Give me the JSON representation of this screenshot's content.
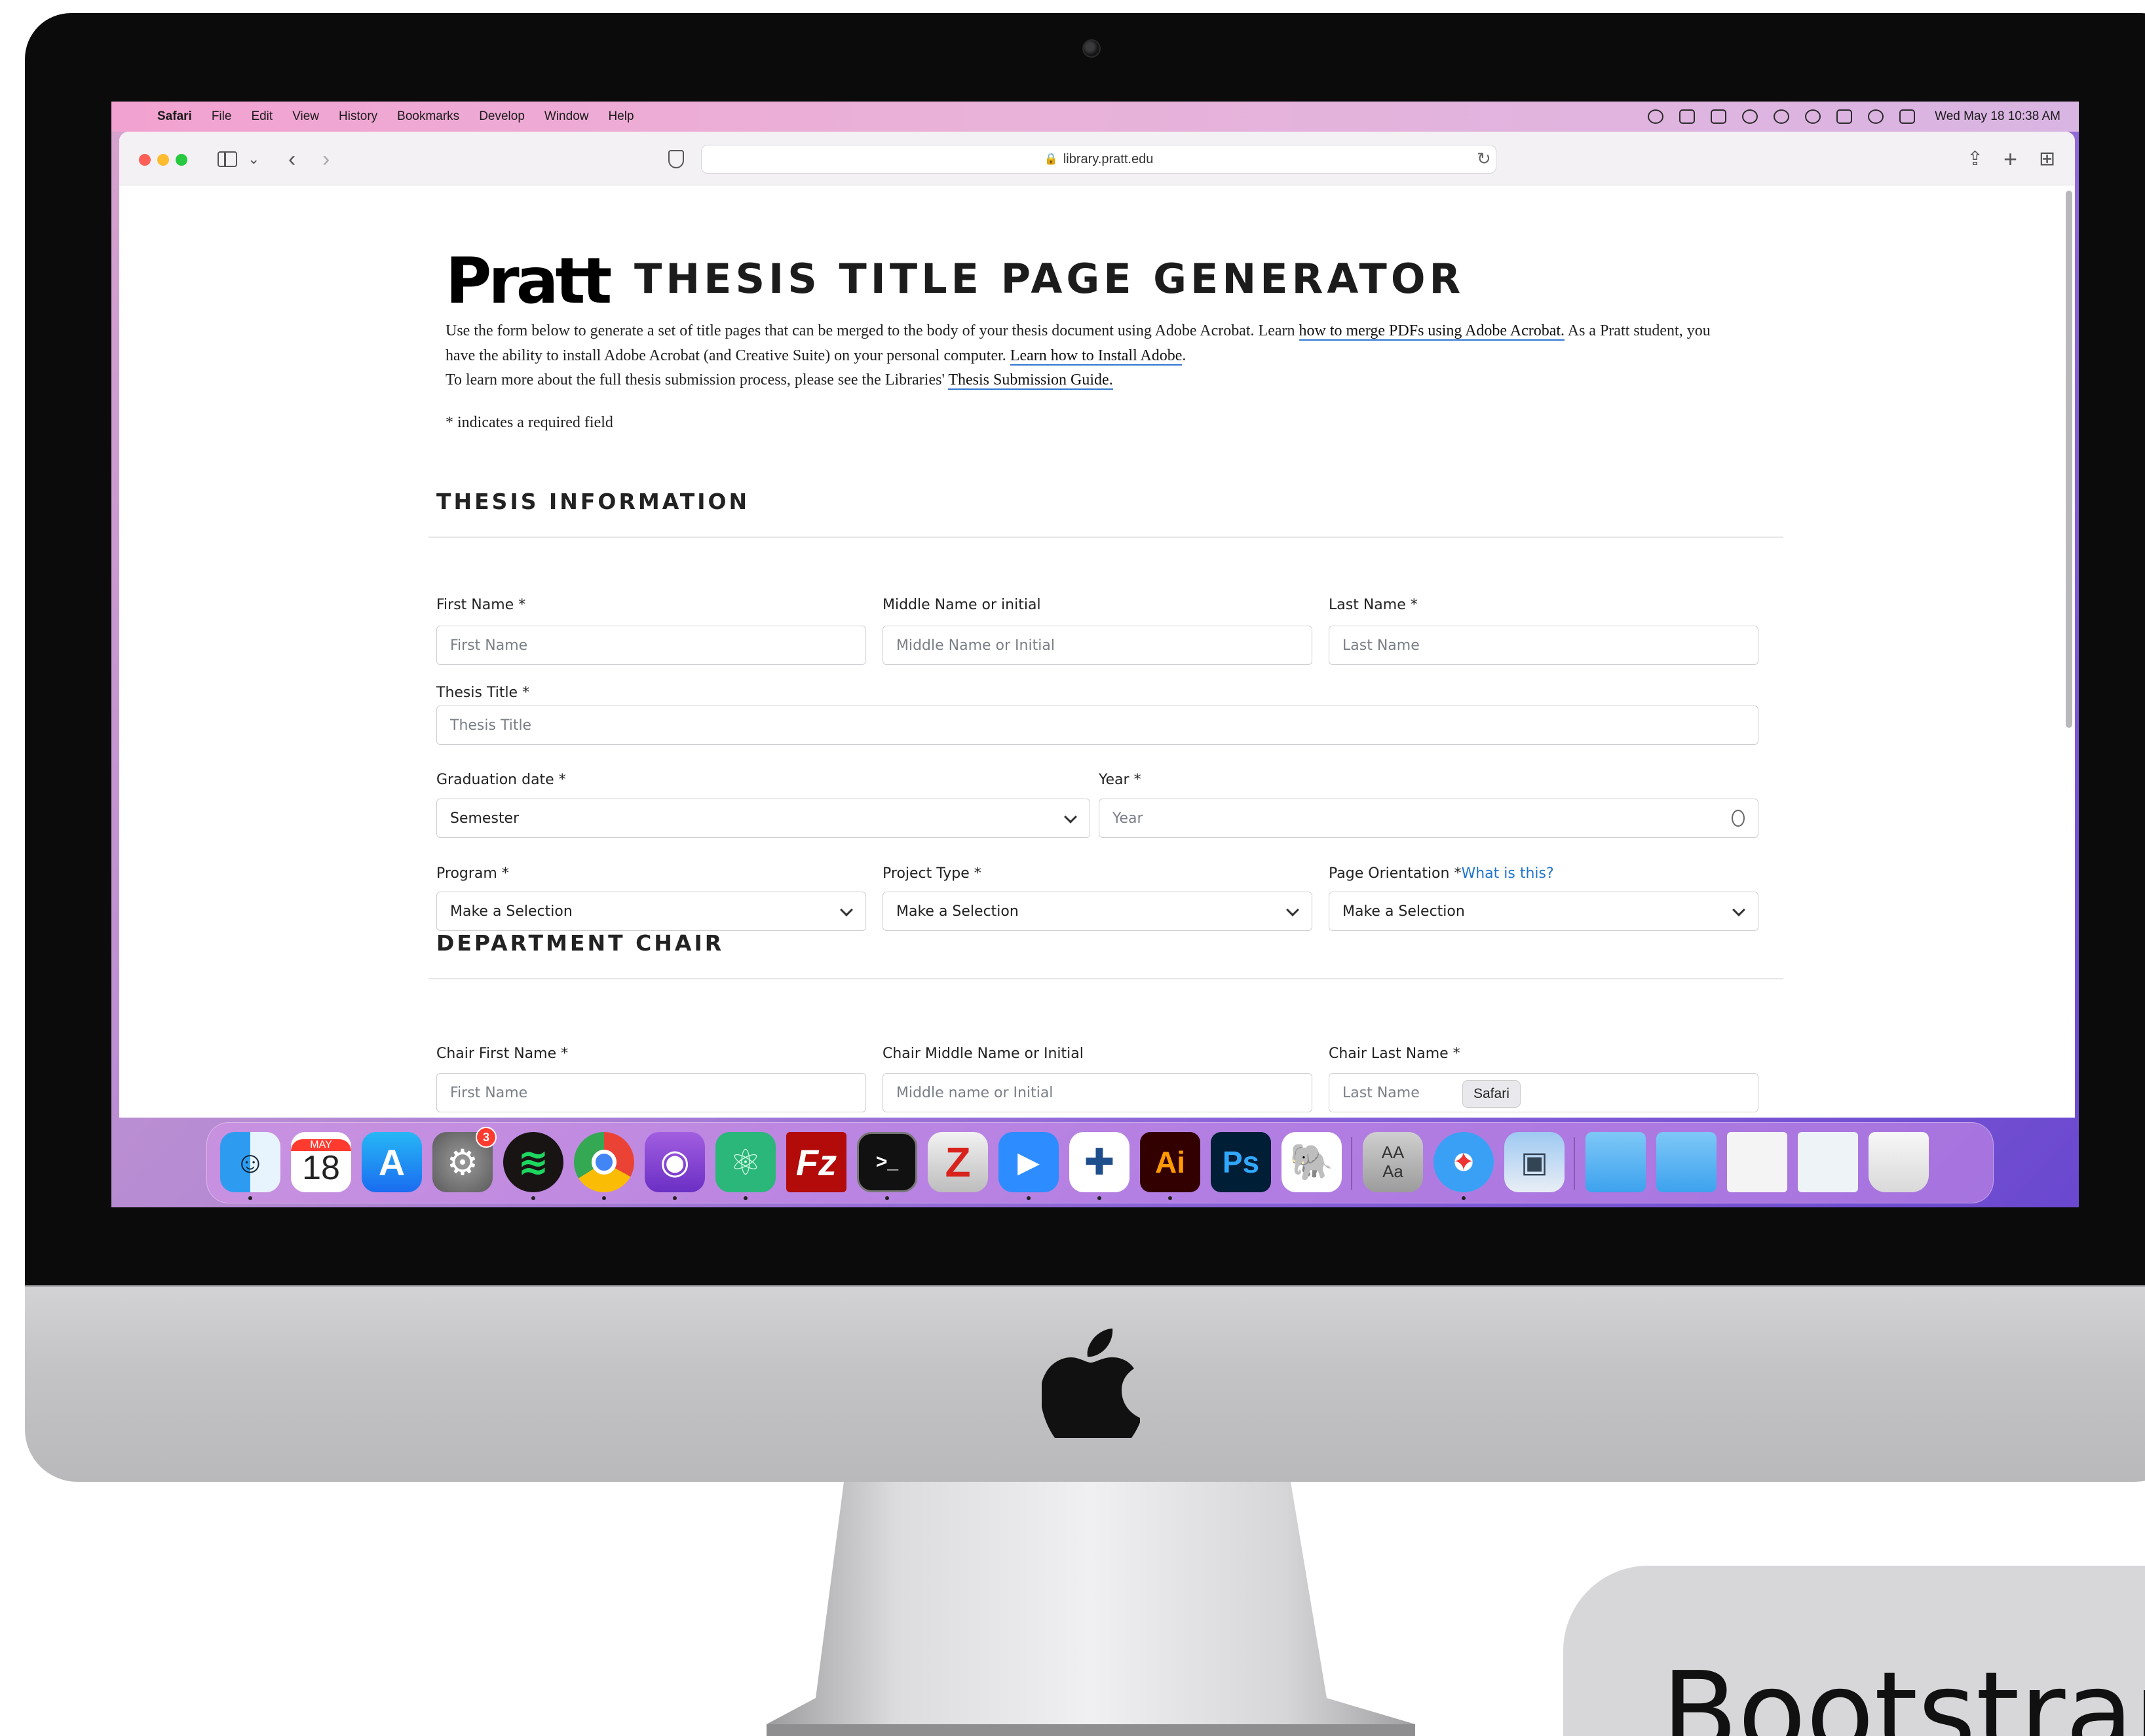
{
  "menubar": {
    "app": "Safari",
    "items": [
      "File",
      "Edit",
      "View",
      "History",
      "Bookmarks",
      "Develop",
      "Window",
      "Help"
    ],
    "clock": "Wed May 18  10:38 AM"
  },
  "browser": {
    "url": "library.pratt.edu",
    "tooltip": "Safari"
  },
  "page": {
    "logo": "Pratt",
    "title": "THESIS TITLE PAGE GENERATOR",
    "intro": {
      "p1_a": "Use the form below to generate a set of title pages that can be merged to the body of your thesis document using Adobe Acrobat. Learn ",
      "p1_link": "how to merge PDFs using Adobe Acrobat.",
      "p1_b": " As a Pratt student, you have the ability to install Adobe Acrobat (and Creative Suite) on your personal computer. ",
      "p1_link2": "Learn how to Install Adobe",
      "p1_c": ".",
      "p2_a": "To learn more about the full thesis submission process, please see the Libraries' ",
      "p2_link": "Thesis Submission Guide.",
      "p3": "* indicates a required field"
    }
  },
  "thesis_info": {
    "heading": "THESIS INFORMATION",
    "first_name": {
      "label": "First Name *",
      "placeholder": "First Name"
    },
    "middle_name": {
      "label": "Middle Name or initial",
      "placeholder": "Middle Name or Initial"
    },
    "last_name": {
      "label": "Last Name *",
      "placeholder": "Last Name"
    },
    "thesis_title": {
      "label": "Thesis Title *",
      "placeholder": "Thesis Title"
    },
    "graduation_date": {
      "label": "Graduation date *",
      "value": "Semester"
    },
    "year": {
      "label": "Year *",
      "placeholder": "Year"
    },
    "program": {
      "label": "Program *",
      "value": "Make a Selection"
    },
    "project_type": {
      "label": "Project Type *",
      "value": "Make a Selection"
    },
    "orientation": {
      "label": "Page Orientation *",
      "help": "What is this?",
      "value": "Make a Selection"
    }
  },
  "department_chair": {
    "heading": "DEPARTMENT CHAIR",
    "first_name": {
      "label": "Chair First Name *",
      "placeholder": "First Name"
    },
    "middle_name": {
      "label": "Chair Middle Name or Initial",
      "placeholder": "Middle name or Initial"
    },
    "last_name": {
      "label": "Chair Last Name *",
      "placeholder": "Last Name"
    }
  },
  "dock": {
    "calendar_month": "MAY",
    "calendar_day": "18",
    "settings_badge": "3",
    "ai_label": "Ai",
    "ps_label": "Ps",
    "fz_label": "Fz",
    "zotero_label": "Z",
    "font_label": "AA\nAa"
  },
  "overlay": {
    "bootstrap": "Bootstrap"
  },
  "colors": {
    "link_underline": "#2f77d1",
    "help_link": "#1e74d0",
    "menubar": "#f2a2d0"
  }
}
